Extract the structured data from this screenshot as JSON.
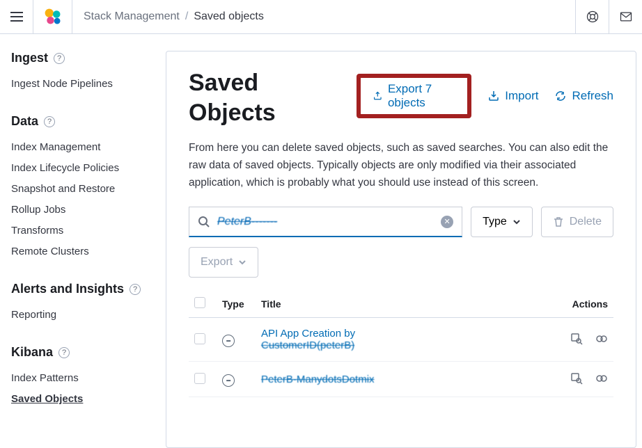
{
  "header": {
    "breadcrumb_root": "Stack Management",
    "breadcrumb_current": "Saved objects"
  },
  "sidebar": {
    "sections": [
      {
        "title": "Ingest",
        "items": [
          "Ingest Node Pipelines"
        ]
      },
      {
        "title": "Data",
        "items": [
          "Index Management",
          "Index Lifecycle Policies",
          "Snapshot and Restore",
          "Rollup Jobs",
          "Transforms",
          "Remote Clusters"
        ]
      },
      {
        "title": "Alerts and Insights",
        "items": [
          "Reporting"
        ]
      },
      {
        "title": "Kibana",
        "items": [
          "Index Patterns",
          "Saved Objects"
        ],
        "active_index": 1
      }
    ]
  },
  "page": {
    "title": "Saved Objects",
    "export_label": "Export 7 objects",
    "import_label": "Import",
    "refresh_label": "Refresh",
    "description": "From here you can delete saved objects, such as saved searches. You can also edit the raw data of saved objects. Typically objects are only modified via their associated application, which is probably what you should use instead of this screen.",
    "search_value": "PeterB-------",
    "type_filter_label": "Type",
    "delete_label": "Delete",
    "export_dropdown_label": "Export"
  },
  "table": {
    "headers": {
      "type": "Type",
      "title": "Title",
      "actions": "Actions"
    },
    "rows": [
      {
        "title_line1": "API App Creation by",
        "title_line2": "CustomerID(peterB)"
      },
      {
        "title_line1": "PeterB-ManydotsDotmix"
      }
    ]
  }
}
